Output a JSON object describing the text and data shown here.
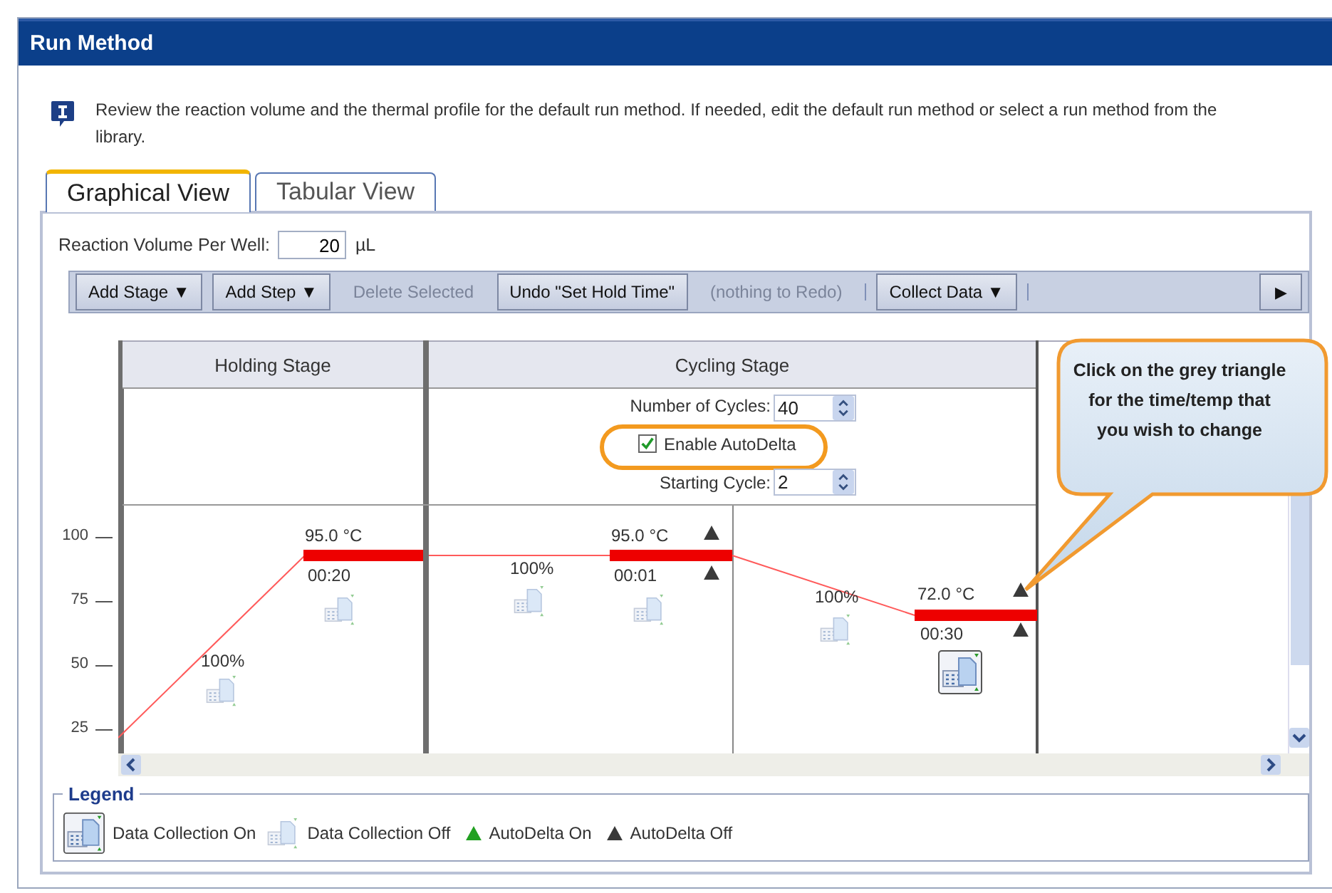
{
  "window": {
    "title": "Run Method"
  },
  "instructions": "Review the reaction volume and the thermal profile for the default run method. If needed, edit the default run method or select a run method from the library.",
  "tabs": [
    {
      "label": "Graphical View",
      "selected": true
    },
    {
      "label": "Tabular View",
      "selected": false
    }
  ],
  "reaction_volume": {
    "label": "Reaction Volume Per Well:",
    "value": "20",
    "unit": "µL"
  },
  "toolbar": [
    {
      "label": "Add Stage ▼",
      "disabled": false
    },
    {
      "label": "Add Step ▼",
      "disabled": false
    },
    {
      "label": "Delete Selected",
      "disabled": true
    },
    {
      "label": "Undo \"Set Hold Time\"",
      "disabled": false
    },
    {
      "label": "(nothing to Redo)",
      "disabled": true
    },
    {
      "label": "Collect Data ▼",
      "disabled": false
    }
  ],
  "toolbar_more": "▶",
  "y_axis_ticks": [
    "100",
    "75",
    "50",
    "25"
  ],
  "stages": [
    {
      "name": "Holding Stage",
      "steps": [
        {
          "ramp": "100%",
          "ramp_collect": false,
          "temp": "95.0 °C",
          "time": "00:20",
          "collect": false
        }
      ]
    },
    {
      "name": "Cycling Stage",
      "number_of_cycles_label": "Number of Cycles:",
      "number_of_cycles": "40",
      "autodelta": {
        "label": "Enable AutoDelta",
        "checked": true
      },
      "starting_cycle_label": "Starting Cycle:",
      "starting_cycle": "2",
      "steps": [
        {
          "ramp": "100%",
          "ramp_collect": false,
          "temp": "95.0 °C",
          "time": "00:01",
          "collect": false,
          "autodelta_on": false
        },
        {
          "ramp": "100%",
          "ramp_collect": false,
          "temp": "72.0 °C",
          "time": "00:30",
          "collect": true,
          "autodelta_on": false
        }
      ]
    }
  ],
  "callout": "Click on the grey triangle for the time/temp that you wish to change",
  "legend": {
    "title": "Legend",
    "items": [
      {
        "kind": "collect_on",
        "label": "Data Collection On"
      },
      {
        "kind": "collect_off",
        "label": "Data Collection Off"
      },
      {
        "kind": "autodelta_on",
        "label": "AutoDelta On"
      },
      {
        "kind": "autodelta_off",
        "label": "AutoDelta Off"
      }
    ]
  }
}
